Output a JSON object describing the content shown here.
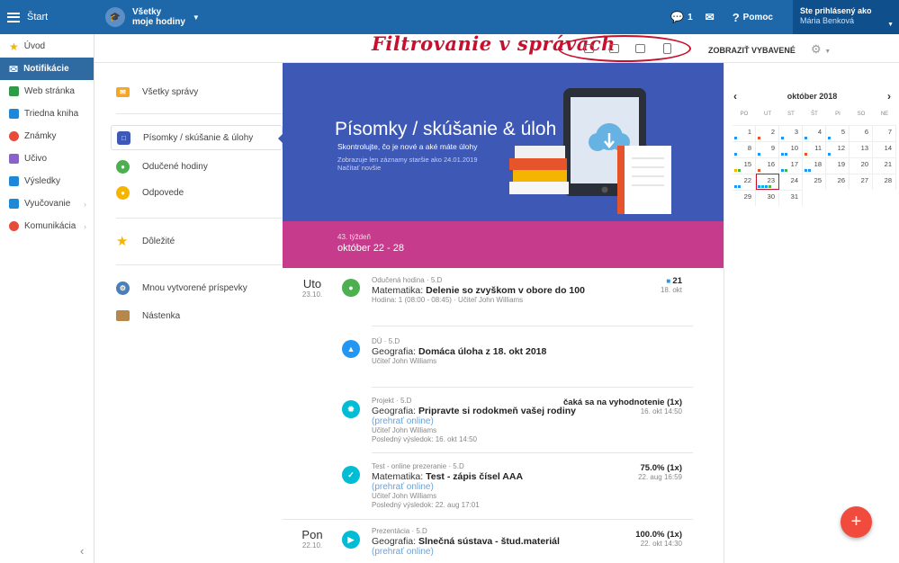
{
  "topbar": {
    "start_label": "Štart",
    "selector_line1": "Všetky",
    "selector_line2": "moje hodiny",
    "chat_count": "1",
    "help_label": "Pomoc",
    "user_line1": "Ste prihlásený ako",
    "user_line2": "Mária Benková",
    "color": "#1e67a8"
  },
  "sidebar": {
    "items": [
      {
        "label": "Úvod",
        "icon": "star-icon",
        "color": "#f5b400"
      },
      {
        "label": "Notifikácie",
        "icon": "envelope-icon",
        "color": "#ffffff"
      },
      {
        "label": "Web stránka",
        "icon": "home-icon",
        "color": "#2e9b4a"
      },
      {
        "label": "Triedna kniha",
        "icon": "book-icon",
        "color": "#1e88d8"
      },
      {
        "label": "Známky",
        "icon": "grade-icon",
        "color": "#e84a3b"
      },
      {
        "label": "Učivo",
        "icon": "folder-icon",
        "color": "#8a63c9"
      },
      {
        "label": "Výsledky",
        "icon": "bar-chart-icon",
        "color": "#1e88d8"
      },
      {
        "label": "Vyučovanie",
        "icon": "briefcase-icon",
        "color": "#1e88d8"
      },
      {
        "label": "Komunikácia",
        "icon": "chat-bubbles-icon",
        "color": "#e84a3b"
      }
    ]
  },
  "annotation": {
    "filter_title": "Filtrovanie v správach",
    "color": "#c8102e"
  },
  "filter_icons": [
    "backpack-icon",
    "monitor-check-icon",
    "presentation-icon",
    "document-edit-icon"
  ],
  "subhead": {
    "show_selected": "ZOBRAZIŤ VYBAVENÉ"
  },
  "middle": {
    "all_messages": "Všetky správy",
    "tests": "Písomky / skúšanie & úlohy",
    "lessons": "Odučené hodiny",
    "answers": "Odpovede",
    "important": "Dôležité",
    "my_posts": "Mnou vytvorené príspevky",
    "board": "Nástenka"
  },
  "hero": {
    "title": "Písomky / skúšanie & úloh",
    "subtitle": "Skontrolujte, čo je nové a aké máte úlohy",
    "note_line1": "Zobrazuje len záznamy staršie ako 24.01.2019",
    "note_line2": "Načítať novšie",
    "color": "#3d58b5"
  },
  "week": {
    "label": "43. týždeň",
    "range": "október 22 - 28",
    "color": "#c63b8c"
  },
  "feed": {
    "day1": {
      "name": "Uto",
      "date": "23.10."
    },
    "day2": {
      "name": "Pon",
      "date": "22.10."
    },
    "items": [
      {
        "type": "Odučená hodina · 5.D",
        "subject": "Matematika:",
        "title": "Delenie so zvyškom v obore do 100",
        "line3": "Hodina: 1 (08:00 - 08:45) · Učiteľ John Williams",
        "right_main": "21",
        "right_sub": "18. okt",
        "icon": "lesson-icon",
        "color": "#4caf50"
      },
      {
        "type": "DÚ · 5.D",
        "subject": "Geografia:",
        "title": "Domáca úloha z 18. okt 2018",
        "line3": "Učiteľ John Williams",
        "icon": "backpack-icon",
        "color": "#2196f3"
      },
      {
        "type": "Projekt · 5.D",
        "subject": "Geografia:",
        "title": "Pripravte si rodokmeň vašej rodiny",
        "link": "(prehrať online)",
        "line3": "Učiteľ John Williams",
        "line4": "Posledný výsledok: 16. okt 14:50",
        "right_main": "čaká sa na vyhodnotenie (1x)",
        "right_sub": "16. okt 14:50",
        "icon": "project-icon",
        "color": "#00bcd4"
      },
      {
        "type": "Test - online prezeranie · 5.D",
        "subject": "Matematika:",
        "title": "Test - zápis čísel AAA",
        "link": "(prehrať online)",
        "line3": "Učiteľ John Williams",
        "line4": "Posledný výsledok: 22. aug 17:01",
        "right_main": "75.0% (1x)",
        "right_sub": "22. aug 16:59",
        "icon": "monitor-check-icon",
        "color": "#00bcd4"
      },
      {
        "type": "Prezentácia · 5.D",
        "subject": "Geografia:",
        "title": "Slnečná sústava - štud.materiál",
        "link": "(prehrať online)",
        "right_main": "100.0% (1x)",
        "right_sub": "22. okt 14:30",
        "icon": "presentation-icon",
        "color": "#00bcd4"
      }
    ]
  },
  "calendar": {
    "month": "október 2018",
    "prev": "‹",
    "next": "›",
    "weekdays": [
      "PO",
      "UT",
      "ST",
      "ŠT",
      "PI",
      "SO",
      "NE"
    ],
    "days": [
      "1",
      "2",
      "3",
      "4",
      "5",
      "6",
      "7",
      "8",
      "9",
      "10",
      "11",
      "12",
      "13",
      "14",
      "15",
      "16",
      "17",
      "18",
      "19",
      "20",
      "21",
      "22",
      "23",
      "24",
      "25",
      "26",
      "27",
      "28",
      "29",
      "30",
      "31"
    ],
    "today": "23"
  },
  "fab": {
    "label": "+"
  }
}
